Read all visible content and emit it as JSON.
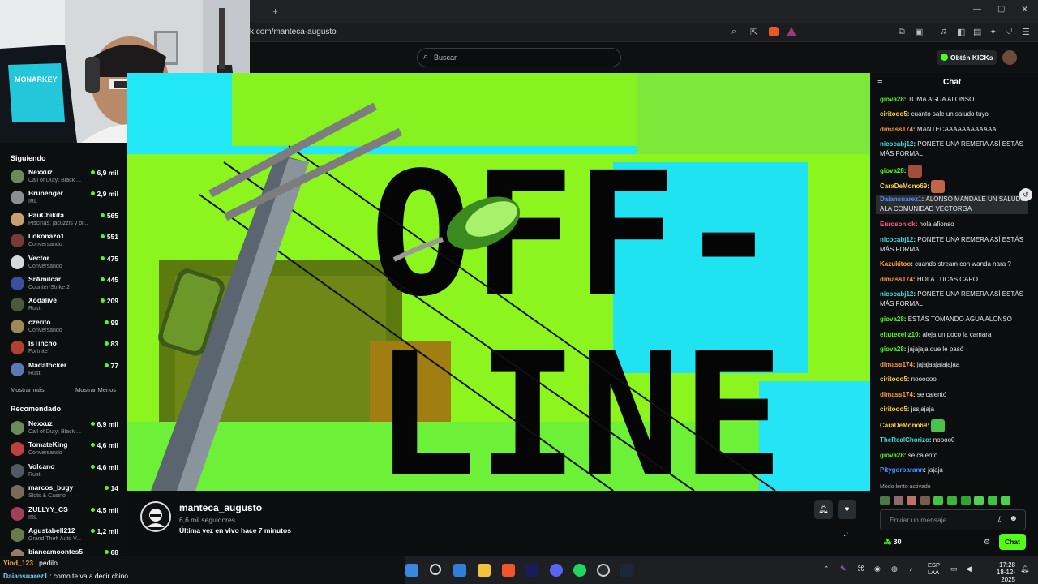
{
  "browser": {
    "url": "k.com/manteca-augusto"
  },
  "header": {
    "search_placeholder": "Buscar",
    "kicks_label": "Obtén KICKs"
  },
  "sidebar": {
    "following_title": "Siguiendo",
    "following": [
      {
        "name": "Nexxuz",
        "category": "Call of Duty: Black ...",
        "viewers": "6,9 mil",
        "color": "#6a8a5a"
      },
      {
        "name": "Brunenger",
        "category": "IRL",
        "viewers": "2,9 mil",
        "color": "#8a8f94"
      },
      {
        "name": "PauChikita",
        "category": "Piscinas, jacuzzis y bi...",
        "viewers": "565",
        "color": "#c9a070"
      },
      {
        "name": "Lokonazo1",
        "category": "Conversando",
        "viewers": "551",
        "color": "#7a3a3a"
      },
      {
        "name": "Vector",
        "category": "Conversando",
        "viewers": "475",
        "color": "#d8d8d8"
      },
      {
        "name": "SrAmilcar",
        "category": "Counter-Strike 2",
        "viewers": "445",
        "color": "#3a4fa0"
      },
      {
        "name": "Xodalive",
        "category": "Rust",
        "viewers": "209",
        "color": "#4a5a3a"
      },
      {
        "name": "czerito",
        "category": "Conversando",
        "viewers": "99",
        "color": "#9a8a5a"
      },
      {
        "name": "IsTincho",
        "category": "Fortnite",
        "viewers": "83",
        "color": "#b04030"
      },
      {
        "name": "Madafocker",
        "category": "Rust",
        "viewers": "77",
        "color": "#5a7ab0"
      }
    ],
    "show_more": "Mostrar más",
    "show_less": "Mostrar Menos",
    "recommended_title": "Recomendado",
    "recommended": [
      {
        "name": "Nexxuz",
        "category": "Call of Duty: Black ...",
        "viewers": "6,9 mil",
        "color": "#6a8a5a"
      },
      {
        "name": "TomateKing",
        "category": "Conversando",
        "viewers": "4,6 mil",
        "color": "#c04040"
      },
      {
        "name": "Volcano",
        "category": "Rust",
        "viewers": "4,6 mil",
        "color": "#505a60"
      },
      {
        "name": "marcos_bugy",
        "category": "Slots & Casino",
        "viewers": "14",
        "color": "#7a6a5a"
      },
      {
        "name": "ZULLYY_CS",
        "category": "IRL",
        "viewers": "4,5 mil",
        "color": "#a0405a"
      },
      {
        "name": "Agustabell212",
        "category": "Grand Theft Auto V...",
        "viewers": "1,2 mil",
        "color": "#6a7a4a"
      },
      {
        "name": "biancamoontes5",
        "category": "",
        "viewers": "68",
        "color": "#9a7a6a"
      }
    ]
  },
  "video": {
    "offline_line1": "OFF-",
    "offline_line2": "LINE"
  },
  "channel": {
    "name": "manteca_augusto",
    "followers": "6,6 mil seguidores",
    "last_live": "Última vez en vivo hace 7 minutos"
  },
  "chat": {
    "title": "Chat",
    "messages": [
      {
        "user": "giova28",
        "color": "#53fc18",
        "text": "TOMA AGUA ALONSO"
      },
      {
        "user": "ciritooo5",
        "color": "#ffd23f",
        "text": "cuánto sale un saludo tuyo"
      },
      {
        "user": "dimass174",
        "color": "#ff9a3c",
        "text": "MANTECAAAAAAAAAAAA"
      },
      {
        "user": "nicocabj12",
        "color": "#3cdfe0",
        "text": "PONETE UNA REMERA ASÍ ESTÁS MÁS FORMAL"
      },
      {
        "user": "giova28",
        "color": "#53fc18",
        "text": ""
      },
      {
        "user": "CaraDeMono69",
        "color": "#ffd23f",
        "text": ""
      },
      {
        "user": "Daiansuarez1",
        "color": "#4f8cff",
        "text": "ALONSO MANDALE UN SALUDO ALA COMUNIDAD VECTORGA"
      },
      {
        "user": "Eurosonick",
        "color": "#ff5c8a",
        "text": "hola afionso"
      },
      {
        "user": "nicocabj12",
        "color": "#3cdfe0",
        "text": "PONETE UNA REMERA ASÍ ESTÁS MÁS FORMAL"
      },
      {
        "user": "Kazukitoo",
        "color": "#ff9a3c",
        "text": "cuando stream con wanda nara ?"
      },
      {
        "user": "dimass174",
        "color": "#ff9a3c",
        "text": "HOLA LUCAS CAPO"
      },
      {
        "user": "nicocabj12",
        "color": "#3cdfe0",
        "text": "PONETE UNA REMERA ASÍ ESTÁS MÁS FORMAL"
      },
      {
        "user": "giova28",
        "color": "#53fc18",
        "text": "ESTÁS TOMANDO AGUA ALONSO"
      },
      {
        "user": "eltuteceliz10",
        "color": "#53fc18",
        "text": "aleja un poco la camara"
      },
      {
        "user": "giova28",
        "color": "#53fc18",
        "text": "jajajaja que le pasó"
      },
      {
        "user": "dimass174",
        "color": "#ff9a3c",
        "text": "jajajaajajajajaa"
      },
      {
        "user": "ciritooo5",
        "color": "#ffd23f",
        "text": "noooooo"
      },
      {
        "user": "dimass174",
        "color": "#ff9a3c",
        "text": "se calentó"
      },
      {
        "user": "ciritooo5",
        "color": "#ffd23f",
        "text": "jssjajaja"
      },
      {
        "user": "CaraDeMono69",
        "color": "#ffd23f",
        "text": ""
      },
      {
        "user": "TheRealChorizo",
        "color": "#3cdfe0",
        "text": "noooo0"
      },
      {
        "user": "giova28",
        "color": "#53fc18",
        "text": "se calentó"
      },
      {
        "user": "Pitygorbarann",
        "color": "#4f8cff",
        "text": "jajaja"
      }
    ],
    "slow_mode": "Modo lento activado",
    "input_placeholder": "Enviar un mensaje",
    "points": "30",
    "send_label": "Chat"
  },
  "overlay_chat": [
    {
      "user": "Yind_123",
      "text": "pedilo",
      "color": "#ffb13c"
    },
    {
      "user": "Daiansuarez1",
      "text": "como te va a decir chino",
      "color": "#6fd0ff"
    }
  ],
  "taskbar": {
    "lang1": "ESP",
    "lang2": "LAA",
    "time": "17:28",
    "date": "18-12-2025"
  }
}
